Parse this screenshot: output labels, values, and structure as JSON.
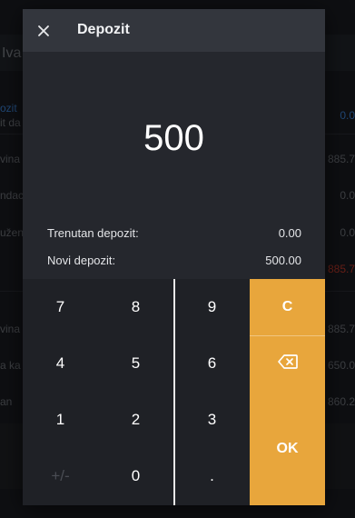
{
  "background": {
    "title_fragment": "Iva",
    "rows": [
      {
        "left": "ozit",
        "right": "0.0"
      },
      {
        "left": "it da",
        "right": ""
      },
      {
        "left": "vina",
        "right": "885.7"
      },
      {
        "left": "ndac",
        "right": "0.0"
      },
      {
        "left": "užen",
        "right": "0.0"
      },
      {
        "left": "",
        "right": "885.7"
      },
      {
        "left": "vina",
        "right": "885.7"
      },
      {
        "left": "a ka",
        "right": "650.0"
      },
      {
        "left": "an",
        "right": "860.2"
      }
    ]
  },
  "modal": {
    "title": "Depozit",
    "amount": "500",
    "info": {
      "current_label": "Trenutan depozit:",
      "current_value": "0.00",
      "new_label": "Novi depozit:",
      "new_value": "500.00"
    }
  },
  "keypad": {
    "keys": [
      {
        "label": "7",
        "name": "key-7"
      },
      {
        "label": "8",
        "name": "key-8"
      },
      {
        "label": "9",
        "name": "key-9"
      },
      {
        "label": "4",
        "name": "key-4"
      },
      {
        "label": "5",
        "name": "key-5"
      },
      {
        "label": "6",
        "name": "key-6"
      },
      {
        "label": "1",
        "name": "key-1"
      },
      {
        "label": "2",
        "name": "key-2"
      },
      {
        "label": "3",
        "name": "key-3"
      },
      {
        "label": "+/-",
        "name": "key-plus-minus"
      },
      {
        "label": "0",
        "name": "key-0"
      },
      {
        "label": ".",
        "name": "key-decimal"
      }
    ],
    "clear_label": "C",
    "backspace_icon": "backspace-icon",
    "ok_label": "OK"
  },
  "colors": {
    "accent": "#e8a63c",
    "negative": "#c0392b",
    "link": "#3b82d6"
  }
}
